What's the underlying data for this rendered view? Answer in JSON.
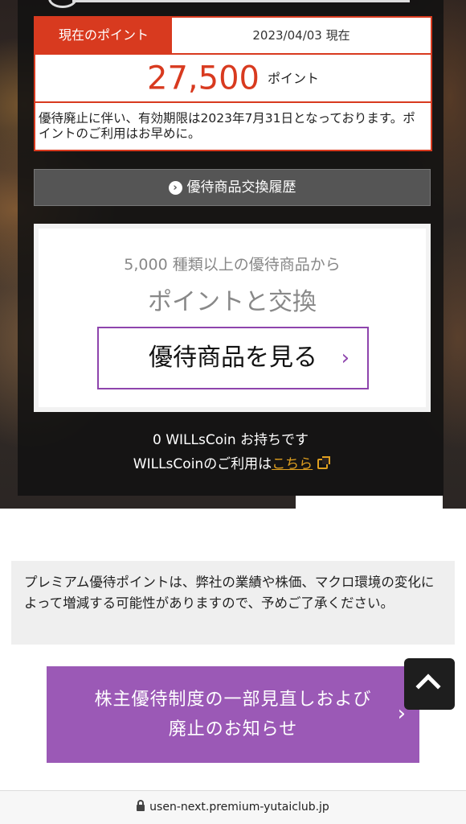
{
  "points": {
    "label": "現在のポイント",
    "date": "2023/04/03 現在",
    "value": "27,500",
    "unit": "ポイント",
    "note": "優待廃止に伴い、有効期限は2023年7月31日となっております。ポイントのご利用はお早めに。"
  },
  "history_button": {
    "label": "優待商品交換履歴",
    "icon": "circle-chevron-right-icon"
  },
  "exchange": {
    "subtitle": "5,000 種類以上の優待商品から",
    "title": "ポイントと交換",
    "button_label": "優待商品を見る",
    "button_icon": "chevron-right-icon"
  },
  "coin": {
    "balance_text": "0 WILLsCoin お持ちです",
    "usage_prefix": "WILLsCoinのご利用は",
    "usage_link": "こちら",
    "link_icon": "external-link-icon"
  },
  "disclaimer": "プレミアム優待ポイントは、弊社の業績や株価、マクロ環境の変化によって増減する可能性がありますので、予めご了承ください。",
  "notice_button": {
    "line1": "株主優待制度の一部見直しおよび",
    "line2": "廃止のお知らせ"
  },
  "scroll_top": {
    "icon": "chevron-up-icon"
  },
  "browser": {
    "url": "usen-next.premium-yutaiclub.jp",
    "lock_icon": "lock-icon"
  },
  "colors": {
    "accent_red": "#d83a1f",
    "accent_purple": "#9b59b6",
    "link_gold": "#e0a020"
  }
}
